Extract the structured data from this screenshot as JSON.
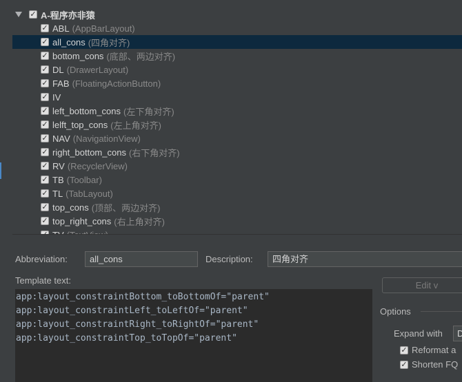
{
  "tree": {
    "root": {
      "label": "A-程序亦非猿",
      "checked": true
    },
    "items": [
      {
        "abbr": "ABL",
        "desc": "(AppBarLayout)",
        "checked": true,
        "selected": false
      },
      {
        "abbr": "all_cons",
        "desc": "(四角对齐)",
        "checked": true,
        "selected": true
      },
      {
        "abbr": "bottom_cons",
        "desc": "(底部、两边对齐)",
        "checked": true,
        "selected": false
      },
      {
        "abbr": "DL",
        "desc": "(DrawerLayout)",
        "checked": true,
        "selected": false
      },
      {
        "abbr": "FAB",
        "desc": "(FloatingActionButton)",
        "checked": true,
        "selected": false
      },
      {
        "abbr": "IV",
        "desc": "",
        "checked": true,
        "selected": false
      },
      {
        "abbr": "left_bottom_cons",
        "desc": "(左下角对齐)",
        "checked": true,
        "selected": false
      },
      {
        "abbr": "lelft_top_cons",
        "desc": "(左上角对齐)",
        "checked": true,
        "selected": false
      },
      {
        "abbr": "NAV",
        "desc": "(NavigationView)",
        "checked": true,
        "selected": false
      },
      {
        "abbr": "right_bottom_cons",
        "desc": "(右下角对齐)",
        "checked": true,
        "selected": false
      },
      {
        "abbr": "RV",
        "desc": "(RecyclerView)",
        "checked": true,
        "selected": false
      },
      {
        "abbr": "TB",
        "desc": "(Toolbar)",
        "checked": true,
        "selected": false
      },
      {
        "abbr": "TL",
        "desc": "(TabLayout)",
        "checked": true,
        "selected": false
      },
      {
        "abbr": "top_cons",
        "desc": "(顶部、两边对齐)",
        "checked": true,
        "selected": false
      },
      {
        "abbr": "top_right_cons",
        "desc": "(右上角对齐)",
        "checked": true,
        "selected": false
      },
      {
        "abbr": "TV",
        "desc": "(TextView)",
        "checked": true,
        "selected": false
      }
    ]
  },
  "form": {
    "abbreviation_label": "Abbreviation:",
    "abbreviation_value": "all_cons",
    "description_label": "Description:",
    "description_value": "四角对齐",
    "template_label": "Template text:",
    "template_lines": [
      "app:layout_constraintBottom_toBottomOf=\"parent\"",
      "app:layout_constraintLeft_toLeftOf=\"parent\"",
      "app:layout_constraintRight_toRightOf=\"parent\"",
      "app:layout_constraintTop_toTopOf=\"parent\""
    ]
  },
  "side": {
    "edit_button": "Edit v",
    "options_label": "Options",
    "expand_label": "Expand with",
    "expand_value": "D",
    "reformat_label": "Reformat a",
    "reformat_checked": true,
    "shorten_label": "Shorten FQ",
    "shorten_checked": true
  },
  "colors": {
    "background": "#3c3f41",
    "selection": "#0d293e",
    "editor_bg": "#2b2b2b",
    "code_text": "#a9b7c6"
  }
}
